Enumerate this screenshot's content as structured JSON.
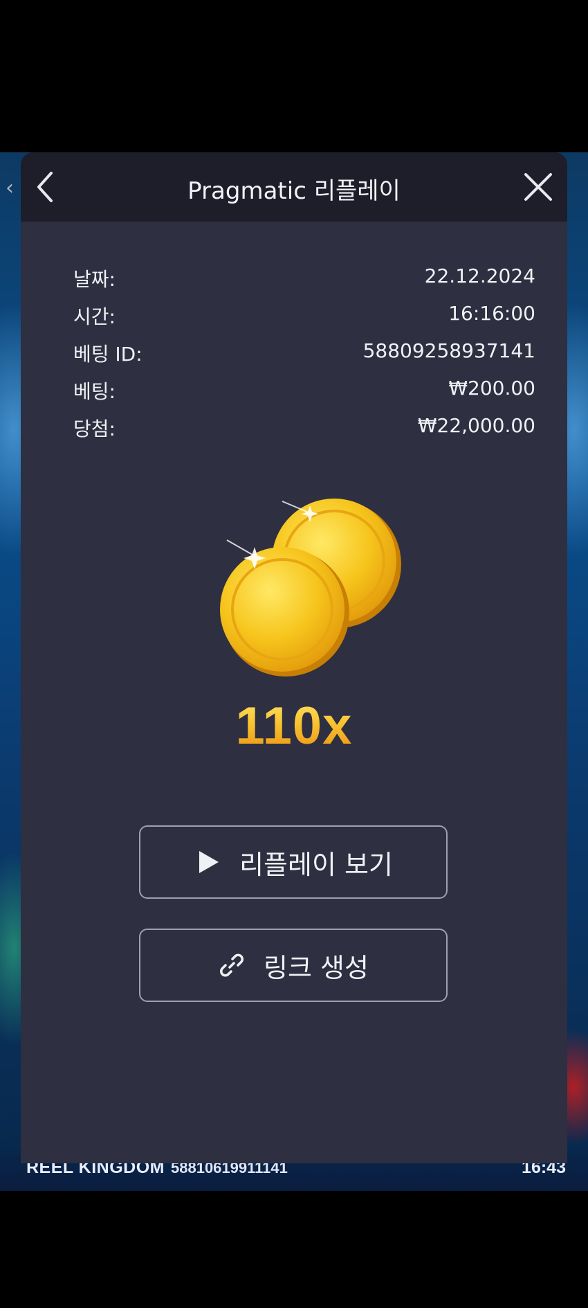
{
  "modal": {
    "title": "Pragmatic 리플레이",
    "back_icon": "chevron-left-icon",
    "close_icon": "close-icon"
  },
  "details": [
    {
      "label": "날짜:",
      "value": "22.12.2024"
    },
    {
      "label": "시간:",
      "value": "16:16:00"
    },
    {
      "label": "베팅 ID:",
      "value": "58809258937141"
    },
    {
      "label": "베팅:",
      "value": "₩200.00"
    },
    {
      "label": "당첨:",
      "value": "₩22,000.00"
    }
  ],
  "result": {
    "multiplier": "110x",
    "icon": "gold-coins-icon"
  },
  "actions": {
    "replay_label": "리플레이 보기",
    "replay_icon": "play-icon",
    "link_label": "링크 생성",
    "link_icon": "link-icon"
  },
  "game_footer": {
    "brand": "REEL KINGDOM",
    "round_id": "58810619911141",
    "time": "16:43"
  },
  "colors": {
    "modal_bg": "#2e2f40",
    "header_bg": "#1d1e2a",
    "gold": "#f6b62b"
  }
}
